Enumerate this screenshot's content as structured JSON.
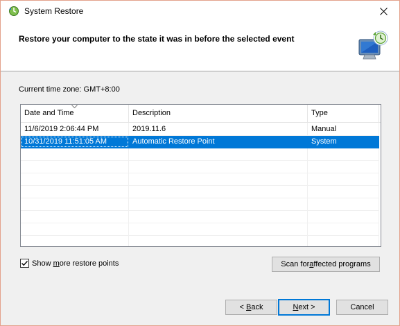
{
  "window": {
    "title": "System Restore"
  },
  "header": {
    "heading": "Restore your computer to the state it was in before the selected event"
  },
  "timezone": {
    "text": "Current time zone: GMT+8:00"
  },
  "table": {
    "columns": [
      "Date and Time",
      "Description",
      "Type"
    ],
    "rows": [
      {
        "date": "11/6/2019 2:06:44 PM",
        "description": "2019.11.6",
        "type": "Manual",
        "selected": false
      },
      {
        "date": "10/31/2019 11:51:05 AM",
        "description": "Automatic Restore Point",
        "type": "System",
        "selected": true
      }
    ]
  },
  "checkbox": {
    "label_pre": "Show ",
    "label_accel": "m",
    "label_post": "ore restore points",
    "checked": true
  },
  "buttons": {
    "scan_pre": "Scan for ",
    "scan_accel": "a",
    "scan_post": "ffected programs",
    "back_pre": "< ",
    "back_accel": "B",
    "back_post": "ack",
    "next_accel": "N",
    "next_post": "ext >",
    "cancel": "Cancel"
  },
  "colors": {
    "selection": "#0078d7",
    "window_border": "#e3a18b",
    "body_bg": "#f0f0f0"
  }
}
